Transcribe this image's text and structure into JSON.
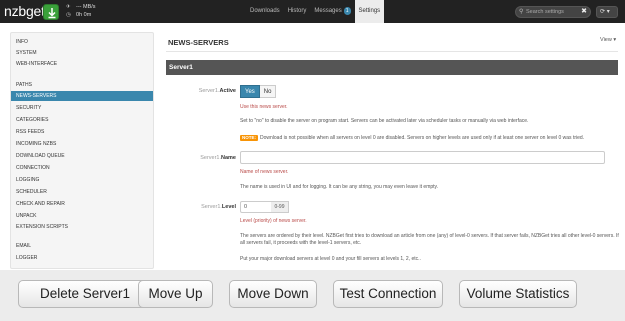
{
  "navbar": {
    "logo": "nzbget",
    "speed": "--- MB/s",
    "time": "0h 0m",
    "tabs": [
      {
        "label": "Downloads"
      },
      {
        "label": "History"
      },
      {
        "label": "Messages",
        "badge": "1"
      },
      {
        "label": "Settings"
      }
    ],
    "search_placeholder": "Search settings",
    "search_clear": "✖",
    "refresh_icon": "⟳ ▾",
    "colors": {
      "bar": "#222222",
      "accent": "#3a87ad",
      "download_button": "#3aa03a"
    }
  },
  "sidebar": {
    "items": [
      {
        "label": "INFO"
      },
      {
        "label": "SYSTEM"
      },
      {
        "label": "WEB-INTERFACE"
      },
      {
        "label": "PATHS"
      },
      {
        "label": "NEWS-SERVERS"
      },
      {
        "label": "SECURITY"
      },
      {
        "label": "CATEGORIES"
      },
      {
        "label": "RSS FEEDS"
      },
      {
        "label": "INCOMING NZBS"
      },
      {
        "label": "DOWNLOAD QUEUE"
      },
      {
        "label": "CONNECTION"
      },
      {
        "label": "LOGGING"
      },
      {
        "label": "SCHEDULER"
      },
      {
        "label": "CHECK AND REPAIR"
      },
      {
        "label": "UNPACK"
      },
      {
        "label": "EXTENSION SCRIPTS"
      },
      {
        "label": "EMAIL"
      },
      {
        "label": "LOGGER"
      }
    ],
    "active": "NEWS-SERVERS"
  },
  "main": {
    "title": "NEWS-SERVERS",
    "view_menu": "View ▾",
    "section": "Server1",
    "active_option": {
      "prefix": "Server1.",
      "name": "Active",
      "yes": "Yes",
      "no": "No",
      "selected": "Yes",
      "use_text": "Use this news server.",
      "help": "Set to \"no\" to disable the server on program start. Servers can be activated later via scheduler tasks or manually via web interface.",
      "note_tag": "NOTE:",
      "note": "Download is not possible when all servers on level 0 are disabled. Servers on higher levels are used only if at least one server on level 0 was tried."
    },
    "name_option": {
      "prefix": "Server1.",
      "name": "Name",
      "value": "",
      "desc": "Name of news server.",
      "help": "The name is used in UI and for logging. It can be any string, you may even leave it empty."
    },
    "level_option": {
      "prefix": "Server1.",
      "name": "Level",
      "value": "0",
      "range": "0-99",
      "desc": "Level (priority) of news server.",
      "help1": "The servers are ordered by their level. NZBGet first tries to download an article from one (any) of level-0 servers. If that server fails, NZBGet tries all other level-0 servers. If all servers fail, it proceeds with the level-1 servers, etc.",
      "help2": "Put your major download servers at level 0 and your fill servers at levels 1, 2, etc.."
    }
  },
  "actions": {
    "delete": "Delete Server1",
    "move_up": "Move Up",
    "move_down": "Move Down",
    "test": "Test Connection",
    "stats": "Volume Statistics"
  }
}
